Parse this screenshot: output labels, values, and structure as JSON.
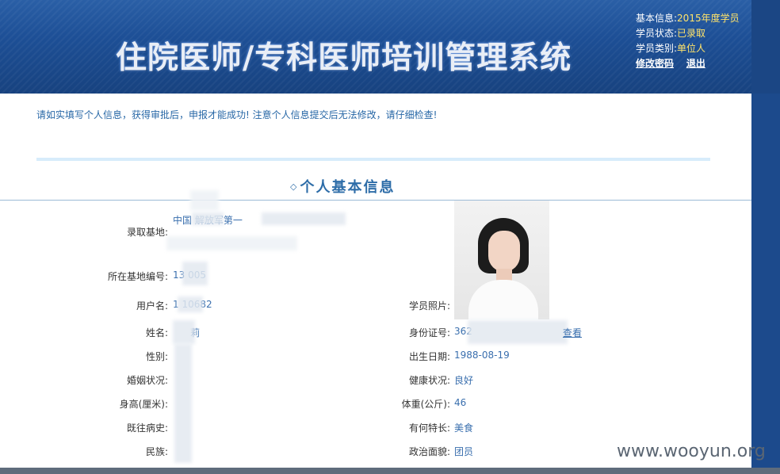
{
  "header": {
    "title": "住院医师/专科医师培训管理系统",
    "user_info": {
      "basic_label": "基本信息:",
      "basic_value": "2015年度学员",
      "status_label": "学员状态:",
      "status_value": "已录取",
      "type_label": "学员类别:",
      "type_value": "单位人",
      "change_password": "修改密码",
      "logout": "退出"
    }
  },
  "notice": "请如实填写个人信息，获得审批后，申报才能成功! 注意个人信息提交后无法修改，请仔细检查!",
  "section": {
    "title": "个人基本信息"
  },
  "form": {
    "base": {
      "label": "录取基地:",
      "value": "中国 解放军第一"
    },
    "base_no": {
      "label": "所在基地编号:",
      "value": "13 005"
    },
    "username": {
      "label": "用户名:",
      "value": "1 10682"
    },
    "name": {
      "label": "姓名:",
      "value": "莉"
    },
    "gender": {
      "label": "性别:"
    },
    "marital": {
      "label": "婚姻状况:"
    },
    "height": {
      "label": "身高(厘米):"
    },
    "history": {
      "label": "既往病史:"
    },
    "ethnicity": {
      "label": "民族:"
    },
    "photo": {
      "label": "学员照片:"
    },
    "id_no": {
      "label": "身份证号:",
      "value": "362",
      "view": "查看"
    },
    "birth": {
      "label": "出生日期:",
      "value": "1988-08-19"
    },
    "health": {
      "label": "健康状况:",
      "value": "良好"
    },
    "weight": {
      "label": "体重(公斤):",
      "value": "46"
    },
    "specialty": {
      "label": "有何特长:",
      "value": "美食"
    },
    "political": {
      "label": "政治面貌:",
      "value": "团员"
    }
  },
  "watermark": "www.wooyun.org"
}
